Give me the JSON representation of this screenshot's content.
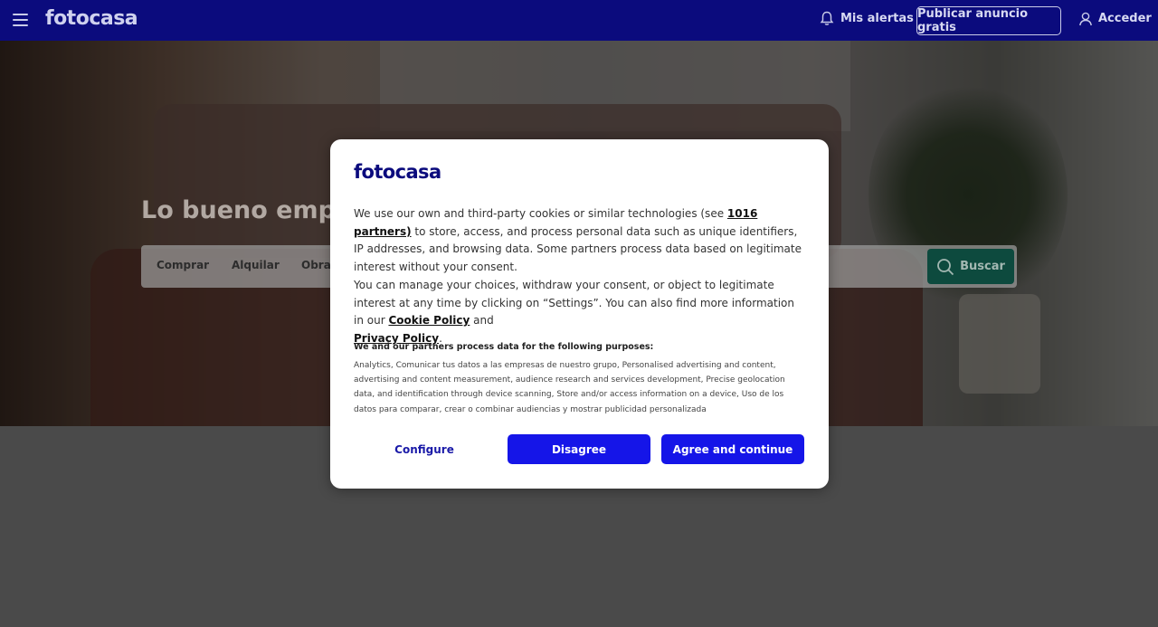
{
  "header": {
    "logo": "fotocasa",
    "alerts_label": "Mis alertas",
    "publish_label": "Publicar anuncio gratis",
    "login_label": "Acceder"
  },
  "hero": {
    "title": "Lo bueno empie",
    "tabs": [
      "Comprar",
      "Alquilar",
      "Obra"
    ],
    "search_label": "Buscar"
  },
  "modal": {
    "logo": "fotocasa",
    "p1_start": "We use our own and third-party cookies or similar technologies (see ",
    "partners_link": "1016 partners)",
    "p1_end": " to store, access, and process personal data such as unique identifiers, IP addresses, and browsing data. Some partners process data based on legitimate interest without your consent.",
    "p2_start": "You can manage your choices, withdraw your consent, or object to legitimate interest at any time by clicking on “Settings”. You can also find more information in our ",
    "cookie_link": "Cookie Policy",
    "p2_mid": " and ",
    "privacy_link": "Privacy Policy",
    "p2_end": ".",
    "purposes_title": "We and our partners process data for the following purposes:",
    "purposes_text": "Analytics, Comunicar tus datos a las empresas de nuestro grupo, Personalised advertising and content, advertising and content measurement, audience research and services development, Precise geolocation data, and identification through device scanning, Store and/or access information on a device, Uso de los datos para comparar, crear o combinar audiencias y mostrar publicidad personalizada",
    "configure_label": "Configure",
    "disagree_label": "Disagree",
    "agree_label": "Agree and continue"
  },
  "colors": {
    "header_bg": "#0b0b7d",
    "primary_button": "#1515e8",
    "brand": "#0b0b7d"
  }
}
